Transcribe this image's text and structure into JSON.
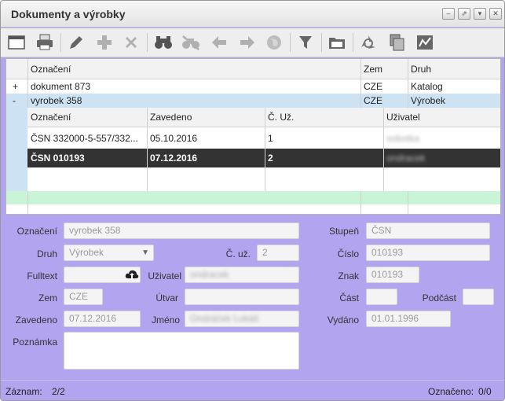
{
  "window": {
    "title": "Dokumenty a výrobky"
  },
  "toolbar": {
    "icons": [
      "new-icon",
      "print-icon",
      "edit-icon",
      "add-icon",
      "delete-icon",
      "search-icon",
      "unfilter-icon",
      "back-icon",
      "forward-icon",
      "web-icon",
      "filter-icon",
      "folder-icon",
      "recycle-icon",
      "copy-icon",
      "chart-icon"
    ]
  },
  "grid": {
    "columns": [
      "Označení",
      "Zem",
      "Druh"
    ],
    "rows": [
      {
        "toggle": "+",
        "oznaceni": "dokument 873",
        "zem": "CZE",
        "druh": "Katalog"
      },
      {
        "toggle": "-",
        "oznaceni": "vyrobek 358",
        "zem": "CZE",
        "druh": "Výrobek"
      }
    ],
    "subgrid": {
      "columns": [
        "Označení",
        "Zavedeno",
        "Č. Už.",
        "Uživatel"
      ],
      "rows": [
        {
          "oznaceni": "ČSN 332000-5-557/332...",
          "zavedeno": "05.10.2016",
          "cuz": "1",
          "uzivatel": "sobotka"
        },
        {
          "oznaceni": "ČSN 010193",
          "zavedeno": "07.12.2016",
          "cuz": "2",
          "uzivatel": "ondracek"
        }
      ]
    }
  },
  "form": {
    "oznaceni": {
      "label": "Označení",
      "value": "vyrobek 358"
    },
    "druh": {
      "label": "Druh",
      "value": "Výrobek"
    },
    "cuz": {
      "label": "Č. už.",
      "value": "2"
    },
    "fulltext": {
      "label": "Fulltext",
      "value": ""
    },
    "uzivatel": {
      "label": "Uživatel",
      "value": "ondracek"
    },
    "zem": {
      "label": "Zem",
      "value": "CZE"
    },
    "utvar": {
      "label": "Útvar",
      "value": ""
    },
    "zavedeno": {
      "label": "Zavedeno",
      "value": "07.12.2016"
    },
    "jmeno": {
      "label": "Jméno",
      "value": "Ondráček Lukáš"
    },
    "poznamka": {
      "label": "Poznámka",
      "value": ""
    },
    "stupen": {
      "label": "Stupeň",
      "value": "ČSN"
    },
    "cislo": {
      "label": "Číslo",
      "value": "010193"
    },
    "znak": {
      "label": "Znak",
      "value": "010193"
    },
    "cast": {
      "label": "Část",
      "value": ""
    },
    "podcast": {
      "label": "Podčást",
      "value": ""
    },
    "vydano": {
      "label": "Vydáno",
      "value": "01.01.1996"
    }
  },
  "status": {
    "zaznam_label": "Záznam:",
    "zaznam_value": "2/2",
    "oznaceno_label": "Označeno:",
    "oznaceno_value": "0/0"
  }
}
